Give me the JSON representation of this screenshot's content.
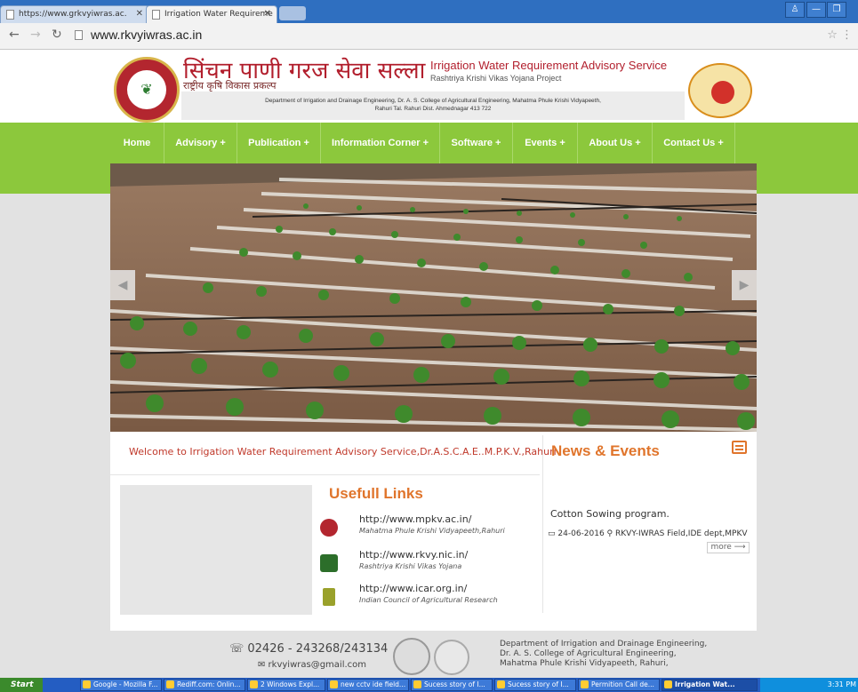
{
  "browser": {
    "tabs": [
      {
        "label": "https://www.grkvyiwras.ac.",
        "active": false
      },
      {
        "label": "Irrigation Water Requireme",
        "active": true
      }
    ],
    "url": "www.rkvyiwras.ac.in"
  },
  "header": {
    "title_hindi": "सिंचन पाणी गरज सेवा सल्ला",
    "subtitle_hindi": "राष्ट्रीय कृषि विकास प्रकल्प",
    "title_english": "Irrigation Water Requirement Advisory Service",
    "subtitle_english": "Rashtriya Krishi Vikas Yojana Project",
    "dept_line1": "Department of Irrigation and Drainage Engineering, Dr. A. S. College of Agricultural Engineering, Mahatma Phule Krishi Vidyapeeth,",
    "dept_line2": "Rahuri Tal. Rahuri Dist. Ahmednagar 413 722",
    "logo_left_text": "MAHATMA PHULE KRISHI VIDYAPEETH"
  },
  "nav": {
    "items": [
      "Home",
      "Advisory +",
      "Publication +",
      "Information Corner +",
      "Software +",
      "Events +",
      "About Us +",
      "Contact Us +"
    ]
  },
  "slider": {
    "prev": "◀",
    "next": "▶"
  },
  "welcome": {
    "text": "Welcome to Irrigation Water Requirement Advisory Service,Dr.A.S.C.A.E..M.P.K.V.,Rahuri"
  },
  "useful_links": {
    "title": "Usefull Links",
    "links": [
      {
        "url": "http://www.mpkv.ac.in/",
        "desc": "Mahatma Phule Krishi Vidyapeeth,Rahuri"
      },
      {
        "url": "http://www.rkvy.nic.in/",
        "desc": "Rashtriya Krishi Vikas Yojana"
      },
      {
        "url": "http://www.icar.org.in/",
        "desc": "Indian Council of Agricultural Research"
      }
    ]
  },
  "news": {
    "title": "News & Events",
    "item_title": "Cotton Sowing program.",
    "item_meta": "24-06-2016 ⚲ RKVY-IWRAS Field,IDE dept,MPKV",
    "more": "more ⟶"
  },
  "footer": {
    "phone": "☏ 02426 - 243268/243134",
    "email": "✉ rkvyiwras@gmail.com",
    "dept_lines": [
      "Department of Irrigation and Drainage Engineering,",
      "Dr. A. S. College of Agricultural Engineering,",
      "Mahatma Phule Krishi Vidyapeeth, Rahuri,"
    ]
  },
  "taskbar": {
    "start": "Start",
    "tasks": [
      {
        "label": "Google - Mozilla F..."
      },
      {
        "label": "Rediff.com: Onlin..."
      },
      {
        "label": "2 Windows Expl..."
      },
      {
        "label": "new cctv ide field..."
      },
      {
        "label": "Sucess story of I..."
      },
      {
        "label": "Sucess story of I..."
      },
      {
        "label": "Permition Call de..."
      },
      {
        "label": "Irrigation Wat..."
      }
    ],
    "clock": "3:31 PM"
  },
  "colors": {
    "nav_green": "#8cc83c",
    "accent_orange": "#e0752c",
    "title_red": "#b21f2d"
  }
}
